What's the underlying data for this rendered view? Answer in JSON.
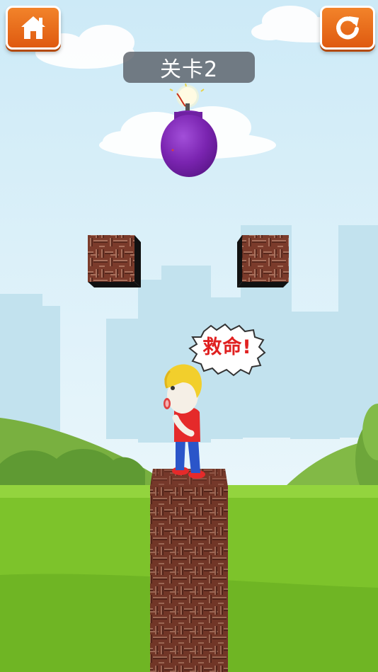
{
  "hud": {
    "level_label": "关卡2"
  },
  "character": {
    "speech": "救命!"
  },
  "icons": {
    "home": "home-icon",
    "restart": "restart-icon"
  },
  "colors": {
    "button_orange": "#e96a1c",
    "bomb_purple": "#7a24b0",
    "sky": "#cfe9f5",
    "grass": "#7cc12a",
    "brick": "#7a3a2a"
  }
}
